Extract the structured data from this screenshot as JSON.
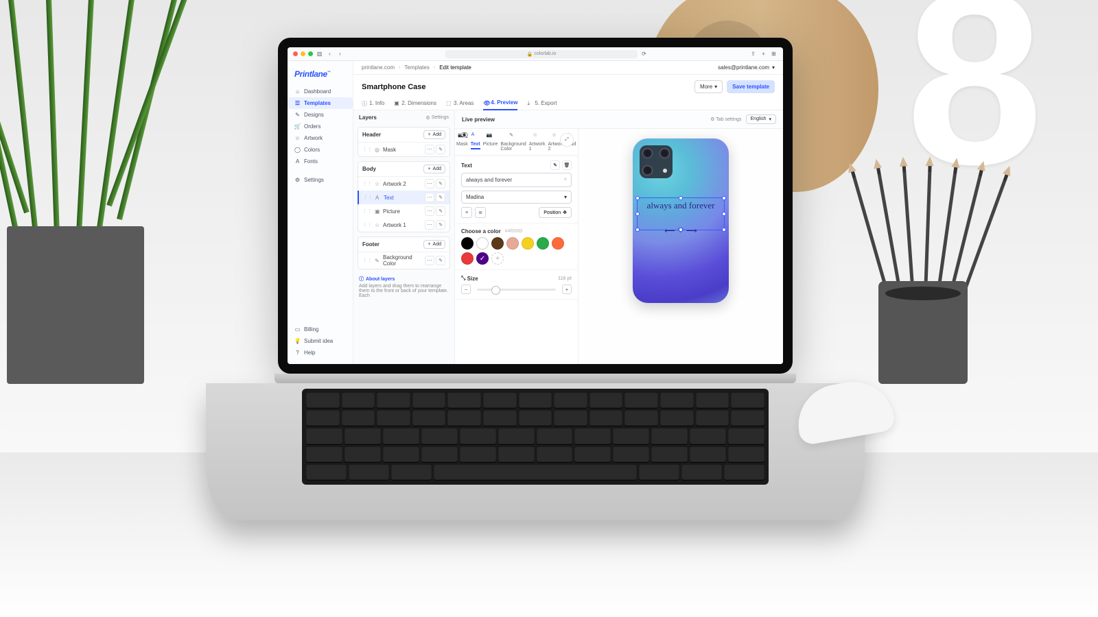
{
  "browser": {
    "url": "colorlab.io"
  },
  "brand": "Printlane",
  "user_email": "sales@printlane.com",
  "breadcrumbs": [
    "printlane.com",
    "Templates",
    "Edit template"
  ],
  "page_title": "Smartphone Case",
  "header_actions": {
    "more": "More",
    "save": "Save template"
  },
  "sidebar": {
    "items": [
      {
        "label": "Dashboard"
      },
      {
        "label": "Templates"
      },
      {
        "label": "Designs"
      },
      {
        "label": "Orders"
      },
      {
        "label": "Artwork"
      },
      {
        "label": "Colors"
      },
      {
        "label": "Fonts"
      }
    ],
    "footer": [
      {
        "label": "Billing"
      },
      {
        "label": "Submit idea"
      },
      {
        "label": "Help"
      }
    ],
    "settings_label": "Settings"
  },
  "tabs": [
    {
      "label": "1. Info"
    },
    {
      "label": "2. Dimensions"
    },
    {
      "label": "3. Areas"
    },
    {
      "label": "4. Preview"
    },
    {
      "label": "5. Export"
    }
  ],
  "layers": {
    "title": "Layers",
    "settings": "Settings",
    "add": "Add",
    "groups": [
      {
        "name": "Header",
        "items": [
          {
            "name": "Mask"
          }
        ]
      },
      {
        "name": "Body",
        "items": [
          {
            "name": "Artwork 2"
          },
          {
            "name": "Text"
          },
          {
            "name": "Picture"
          },
          {
            "name": "Artwork 1"
          }
        ]
      },
      {
        "name": "Footer",
        "items": [
          {
            "name": "Background Color"
          }
        ]
      }
    ],
    "about_title": "About layers",
    "about_text": "Add layers and drag them to rearrange them to the front or back of your template. Each"
  },
  "preview": {
    "title": "Live preview",
    "tab_settings": "Tab settings",
    "language": "English",
    "ctrl_tabs": [
      "Mask",
      "Text",
      "Picture",
      "Background Color",
      "Artwork 1",
      "Artwork 2",
      "Add"
    ],
    "text_section": {
      "title": "Text",
      "value": "always and forever",
      "font": "Madina",
      "position": "Position"
    },
    "color_section": {
      "title": "Choose a color",
      "code": "#4f0089",
      "swatches": [
        "#000000",
        "#ffffff",
        "#5a3a1a",
        "#e8a898",
        "#f5d020",
        "#2aaa4a",
        "#ff6a3a",
        "#e83a3a",
        "#4f0089"
      ]
    },
    "size_section": {
      "title": "Size",
      "value": "116 pt"
    },
    "phone_text": "always and forever"
  }
}
